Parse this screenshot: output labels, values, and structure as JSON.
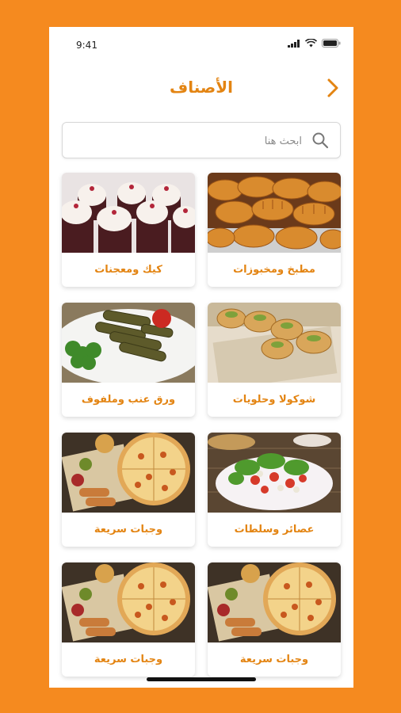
{
  "status_bar": {
    "time": "9:41"
  },
  "header": {
    "title": "الأصناف"
  },
  "search": {
    "placeholder": "ابحث هنا"
  },
  "categories": [
    {
      "label": "مطبخ ومخبوزات",
      "image": "croissants"
    },
    {
      "label": "كيك ومعجنات",
      "image": "cupcakes"
    },
    {
      "label": "شوكولا وحلويات",
      "image": "pastries"
    },
    {
      "label": "ورق عنب وملفوف",
      "image": "stuffed-grape-leaves"
    },
    {
      "label": "عصائر وسلطات",
      "image": "salad"
    },
    {
      "label": "وجبات سريعة",
      "image": "pizza-fastfood"
    },
    {
      "label": "وجبات سريعة",
      "image": "pizza-fastfood"
    },
    {
      "label": "وجبات سريعة",
      "image": "pizza-fastfood"
    }
  ],
  "colors": {
    "accent": "#E38412",
    "background": "#F58A1F"
  }
}
